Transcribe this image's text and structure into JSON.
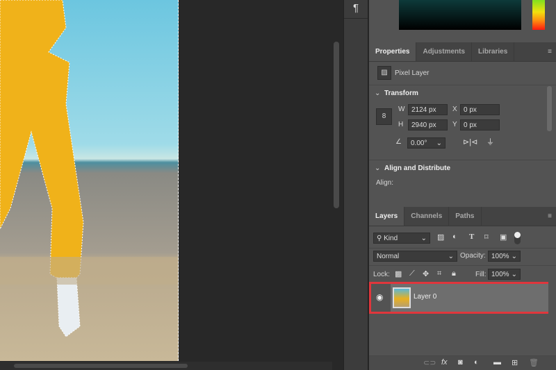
{
  "properties_panel": {
    "tabs": [
      "Properties",
      "Adjustments",
      "Libraries"
    ],
    "layer_type": "Pixel Layer",
    "transform": {
      "title": "Transform",
      "w_label": "W",
      "w": "2124 px",
      "h_label": "H",
      "h": "2940 px",
      "x_label": "X",
      "x": "0 px",
      "y_label": "Y",
      "y": "0 px",
      "angle": "0.00°"
    },
    "align": {
      "title": "Align and Distribute",
      "label": "Align:"
    }
  },
  "layers_panel": {
    "tabs": [
      "Layers",
      "Channels",
      "Paths"
    ],
    "filter": "Kind",
    "blend_mode": "Normal",
    "opacity_label": "Opacity:",
    "opacity": "100%",
    "lock_label": "Lock:",
    "fill_label": "Fill:",
    "fill": "100%",
    "layers": [
      {
        "name": "Layer 0",
        "visible": true,
        "selected": true
      }
    ]
  },
  "highlight_color": "#e0363c"
}
